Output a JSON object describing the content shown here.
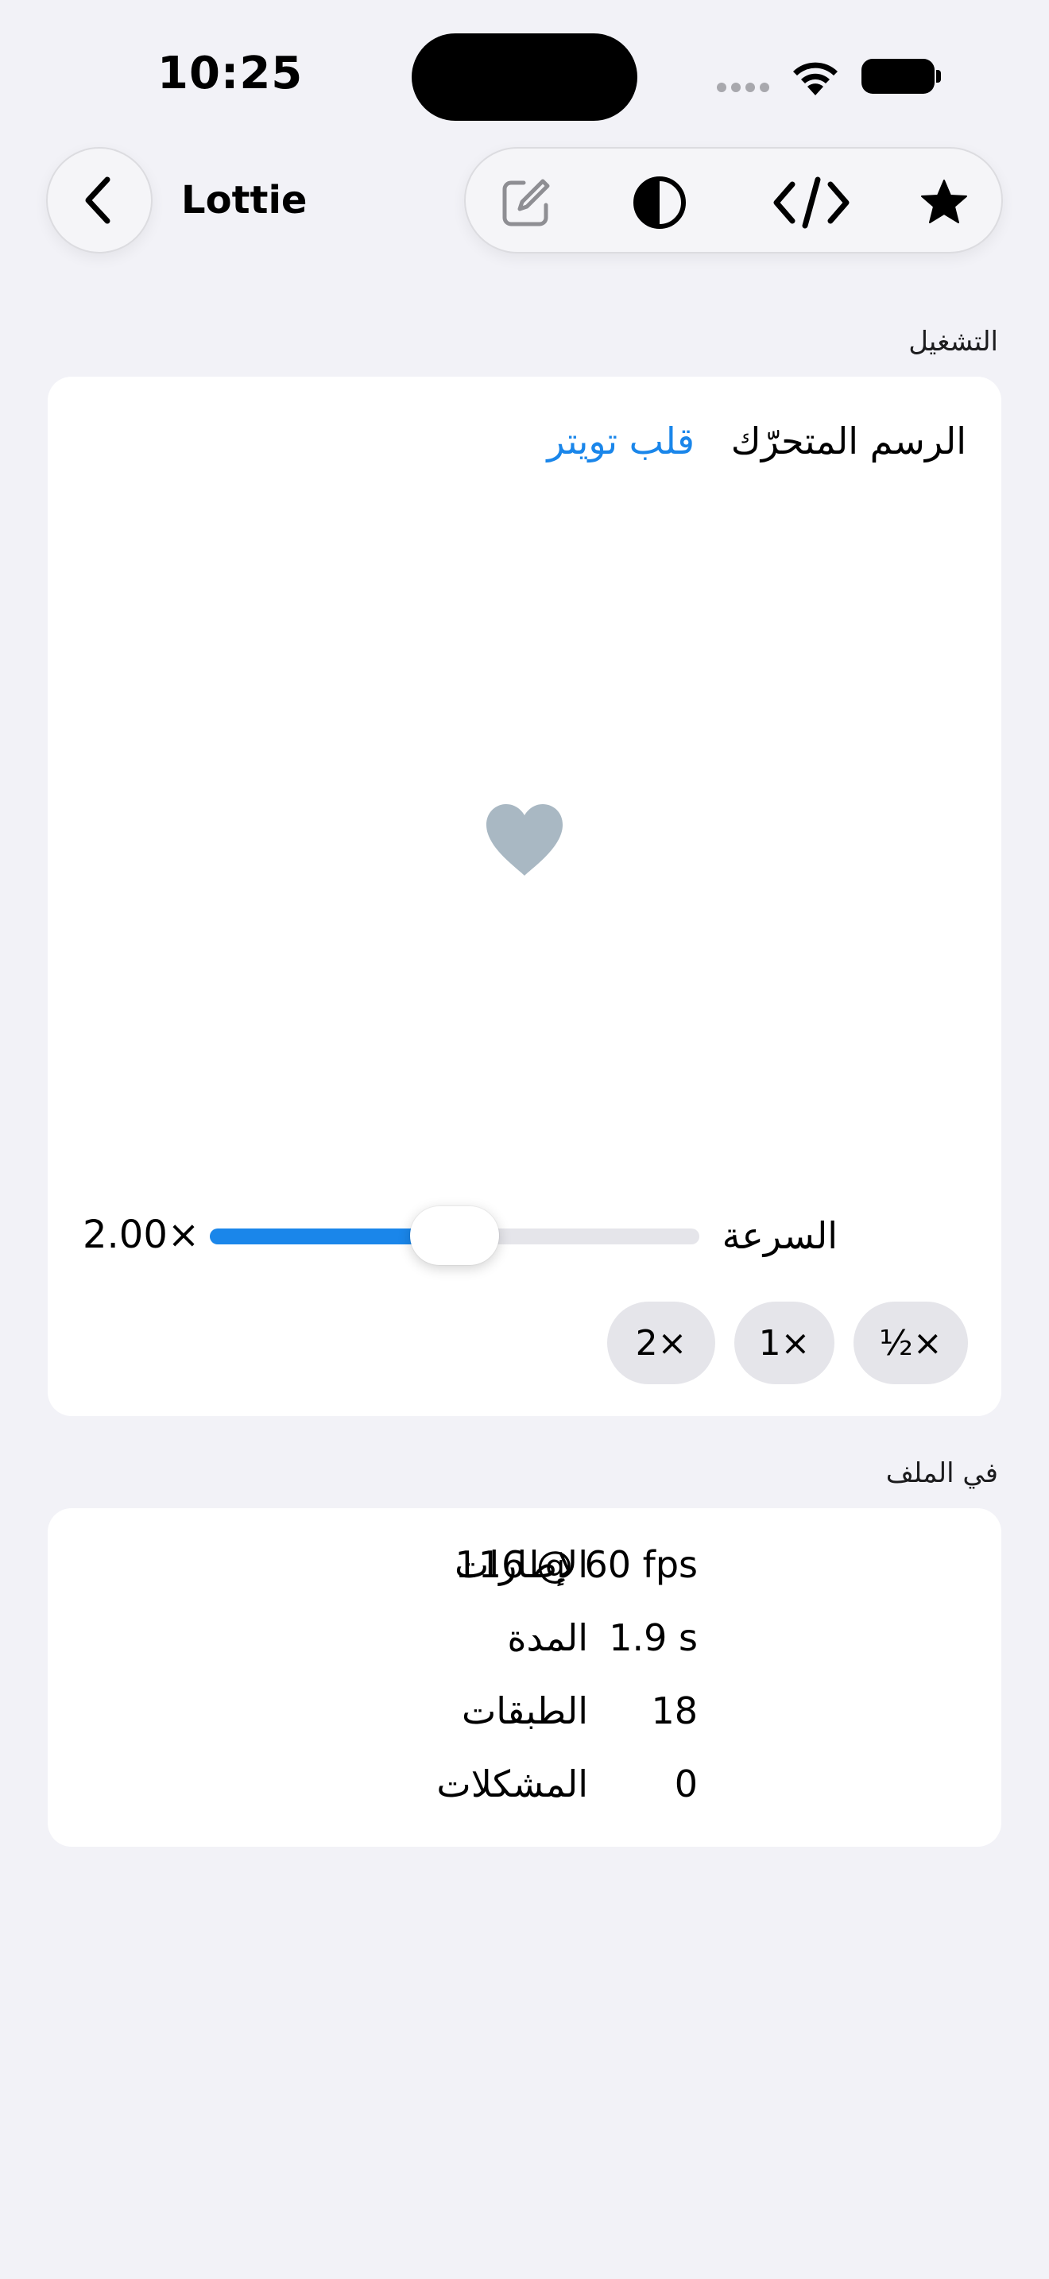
{
  "status_bar": {
    "time": "10:25"
  },
  "nav": {
    "title": "Lottie",
    "back_icon": "chevron-left-icon",
    "tools": [
      "edit-icon",
      "contrast-icon",
      "code-icon",
      "star-icon"
    ]
  },
  "playback": {
    "section_title": "التشغيل",
    "animation_label": "الرسم المتحرّك",
    "animation_value": "قلب تويتر",
    "preview_icon": "heart-icon",
    "speed_label": "السرعة",
    "speed_value": "2.00×",
    "speed_fraction": 0.5,
    "presets": {
      "half": "½×",
      "one": "1×",
      "two": "2×"
    }
  },
  "file": {
    "section_title": "في الملف",
    "rows": [
      {
        "label": "الإطارات",
        "value": "116 @ 60 fps"
      },
      {
        "label": "المدة",
        "value": "1.9 s"
      },
      {
        "label": "الطبقات",
        "value": "18"
      },
      {
        "label": "المشكلات",
        "value": "0"
      }
    ]
  },
  "colors": {
    "accent": "#1a86ea",
    "background": "#f2f2f7",
    "heart": "#a9b8c3"
  }
}
